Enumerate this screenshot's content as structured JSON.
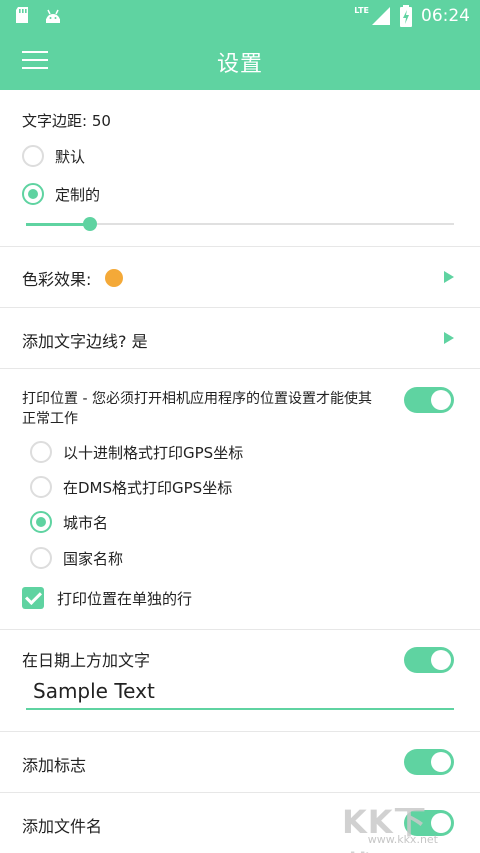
{
  "status_bar": {
    "left_icons": [
      "sdcard-icon",
      "android-icon"
    ],
    "network": "LTE",
    "time": "06:24"
  },
  "app_bar": {
    "title": "设置"
  },
  "text_margin": {
    "label": "文字边距: 50",
    "options": [
      {
        "label": "默认",
        "checked": false
      },
      {
        "label": "定制的",
        "checked": true
      }
    ],
    "slider_fraction": 0.15
  },
  "color_effect": {
    "label": "色彩效果:",
    "color": "#f4a938"
  },
  "text_border": {
    "label": "添加文字边线? 是"
  },
  "print_location": {
    "label": "打印位置 - 您必须打开相机应用程序的位置设置才能使其正常工作",
    "enabled": true,
    "options": [
      {
        "label": "以十进制格式打印GPS坐标",
        "checked": false
      },
      {
        "label": "在DMS格式打印GPS坐标",
        "checked": false
      },
      {
        "label": "城市名",
        "checked": true
      },
      {
        "label": "国家名称",
        "checked": false
      }
    ],
    "separate_line": {
      "label": "打印位置在单独的行",
      "checked": true
    }
  },
  "date_text": {
    "label": "在日期上方加文字",
    "enabled": true,
    "value": "Sample Text"
  },
  "add_logo": {
    "label": "添加标志",
    "enabled": true
  },
  "add_filename": {
    "label": "添加文件名",
    "enabled": true
  },
  "watermark": {
    "brand": "KK下载",
    "url": "www.kkx.net"
  },
  "colors": {
    "accent": "#5fd3a1",
    "orange": "#f4a938"
  }
}
